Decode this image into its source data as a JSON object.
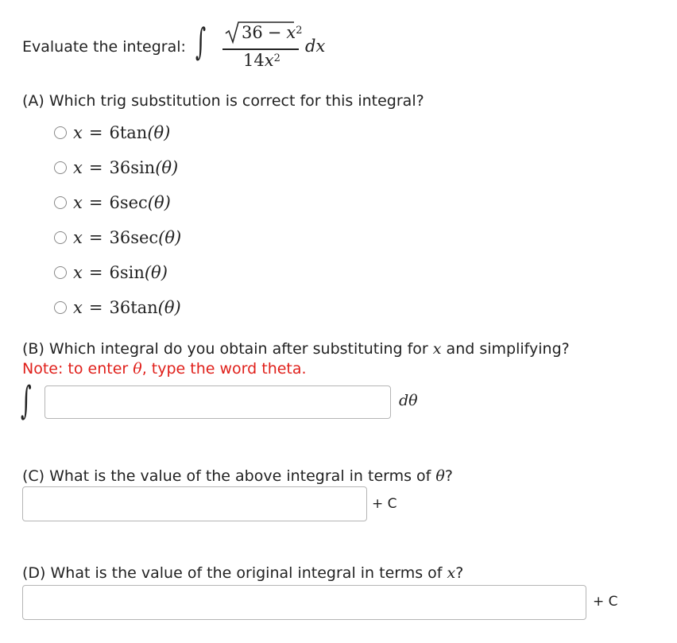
{
  "intro": {
    "label": "Evaluate the integral:",
    "integral_sign": "∫",
    "numerator_radicand_const": "36",
    "minus": "−",
    "numerator_var": "x",
    "numerator_exp": "2",
    "denominator_coef": "14",
    "denominator_var": "x",
    "denominator_exp": "2",
    "differential": "dx"
  },
  "partA": {
    "question": "(A) Which trig substitution is correct for this integral?",
    "options": [
      {
        "var": "x",
        "eq": "=",
        "coef": "6",
        "func": "tan",
        "arg": "(θ)"
      },
      {
        "var": "x",
        "eq": "=",
        "coef": "36",
        "func": "sin",
        "arg": "(θ)"
      },
      {
        "var": "x",
        "eq": "=",
        "coef": "6",
        "func": "sec",
        "arg": "(θ)"
      },
      {
        "var": "x",
        "eq": "=",
        "coef": "36",
        "func": "sec",
        "arg": "(θ)"
      },
      {
        "var": "x",
        "eq": "=",
        "coef": "6",
        "func": "sin",
        "arg": "(θ)"
      },
      {
        "var": "x",
        "eq": "=",
        "coef": "36",
        "func": "tan",
        "arg": "(θ)"
      }
    ]
  },
  "partB": {
    "question_prefix": "(B) Which integral do you obtain after substituting for ",
    "question_var": "x",
    "question_suffix": " and simplifying?",
    "note_prefix": "Note: to enter ",
    "note_theta": "θ",
    "note_suffix": ", type the word theta.",
    "integral_sign": "∫",
    "input_value": "",
    "differential": "dθ"
  },
  "partC": {
    "question_prefix": "(C) What is the value of the above integral in terms of ",
    "question_theta": "θ",
    "question_suffix": "?",
    "input_value": "",
    "constant": "+ C"
  },
  "partD": {
    "question_prefix": "(D) What is the value of the original integral in terms of ",
    "question_var": "x",
    "question_suffix": "?",
    "input_value": "",
    "constant": "+ C"
  },
  "colors": {
    "note": "#e0201b",
    "input_border": "#b5b5b5",
    "radio_border": "#888888"
  }
}
